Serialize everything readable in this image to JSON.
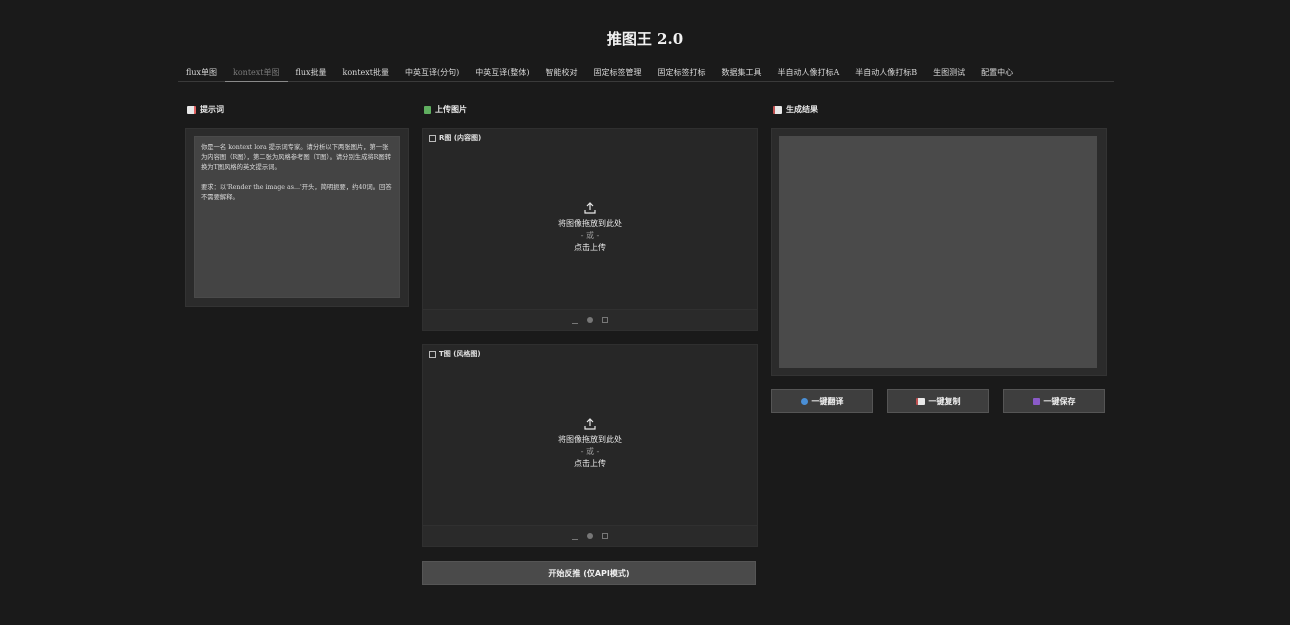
{
  "app": {
    "title": "推图王 2.0"
  },
  "tabs": [
    {
      "label": "flux单图"
    },
    {
      "label": "kontext单图",
      "active": true
    },
    {
      "label": "flux批量"
    },
    {
      "label": "kontext批量"
    },
    {
      "label": "中英互译(分句)"
    },
    {
      "label": "中英互译(整体)"
    },
    {
      "label": "智能校对"
    },
    {
      "label": "固定标签管理"
    },
    {
      "label": "固定标签打标"
    },
    {
      "label": "数据集工具"
    },
    {
      "label": "半自动人像打标A"
    },
    {
      "label": "半自动人像打标B"
    },
    {
      "label": "生图测试"
    },
    {
      "label": "配置中心"
    }
  ],
  "prompt_section": {
    "title": "提示词",
    "text": "你是一名 kontext lora 提示词专家。请分析以下两张图片，第一张为内容图（R图），第二张为风格参考图（T图）。请分别生成将R图转换为T图风格的英文提示词。\n\n要求：以'Render the image as...'开头，简明扼要，约40词。回答不需要解释。"
  },
  "upload_section": {
    "title": "上传图片",
    "r_label": "R图 (内容图)",
    "t_label": "T图 (风格图)",
    "drop_text": "将图像拖放到此处",
    "or_text": "- 或 -",
    "click_text": "点击上传"
  },
  "start_button": "开始反推 (仅API模式)",
  "result_section": {
    "title": "生成结果",
    "translate_label": "一键翻译",
    "copy_label": "一键复制",
    "save_label": "一键保存"
  }
}
